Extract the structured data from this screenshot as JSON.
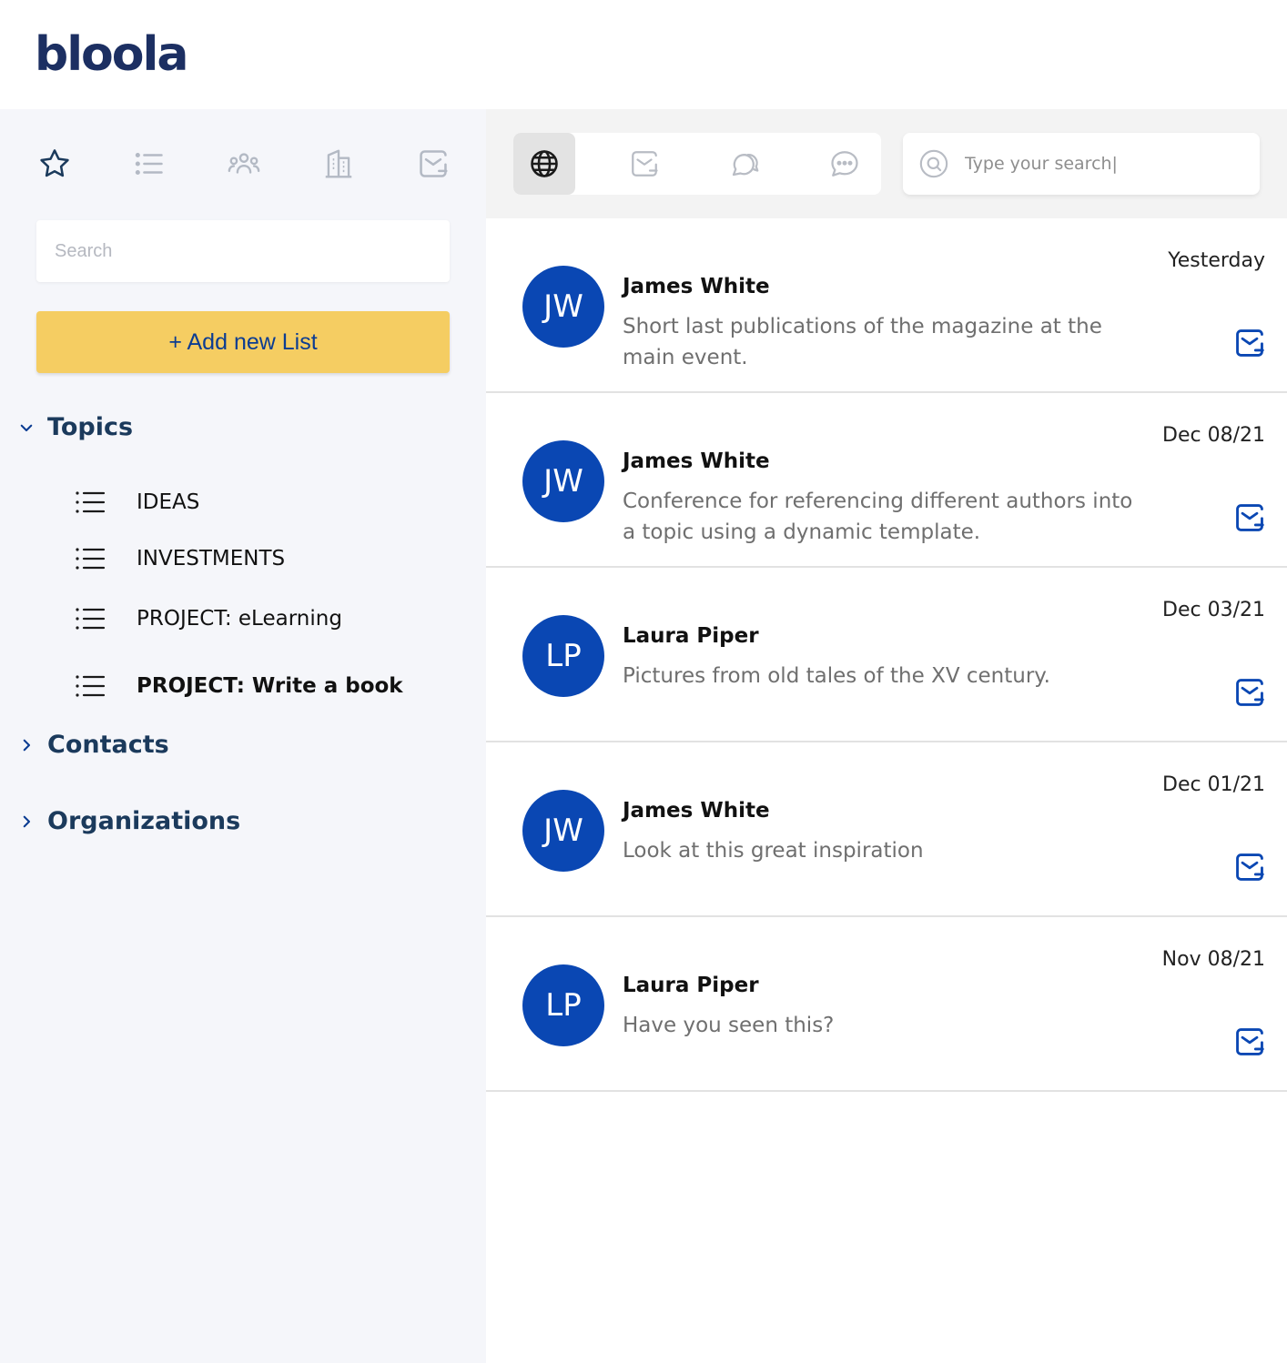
{
  "app": {
    "logo_text": "bloola"
  },
  "sidebar": {
    "tabs": [
      {
        "icon": "star-icon",
        "active": true
      },
      {
        "icon": "list-icon",
        "active": false
      },
      {
        "icon": "people-icon",
        "active": false
      },
      {
        "icon": "building-icon",
        "active": false
      },
      {
        "icon": "mail-icon",
        "active": false
      }
    ],
    "search_placeholder": "Search",
    "add_button_label": "+ Add new List",
    "sections": {
      "topics": {
        "label": "Topics",
        "expanded": true
      },
      "contacts": {
        "label": "Contacts",
        "expanded": false
      },
      "organizations": {
        "label": "Organizations",
        "expanded": false
      }
    },
    "topics": [
      {
        "label": "IDEAS",
        "active": false
      },
      {
        "label": "INVESTMENTS",
        "active": false
      },
      {
        "label": "PROJECT: eLearning",
        "active": false
      },
      {
        "label": "PROJECT: Write a book",
        "active": true
      }
    ]
  },
  "main": {
    "tabs": [
      {
        "icon": "globe-icon",
        "active": true
      },
      {
        "icon": "mail-icon",
        "active": false
      },
      {
        "icon": "chat-bubbles-icon",
        "active": false
      },
      {
        "icon": "comment-icon",
        "active": false
      }
    ],
    "search_placeholder": "Type your search|",
    "messages": [
      {
        "initials": "JW",
        "sender": "James White",
        "preview": "Short last publications of the magazine at the main event.",
        "date": "Yesterday"
      },
      {
        "initials": "JW",
        "sender": "James White",
        "preview": "Conference for referencing different authors into a topic using a dynamic template.",
        "date": "Dec 08/21"
      },
      {
        "initials": "LP",
        "sender": "Laura Piper",
        "preview": "Pictures from old tales of the XV century.",
        "date": "Dec 03/21"
      },
      {
        "initials": "JW",
        "sender": "James White",
        "preview": "Look at this great inspiration",
        "date": "Dec 01/21"
      },
      {
        "initials": "LP",
        "sender": "Laura Piper",
        "preview": "Have you seen this?",
        "date": "Nov 08/21"
      }
    ]
  },
  "colors": {
    "brand_navy": "#1c2f62",
    "accent_yellow": "#f5cd62",
    "avatar_blue": "#0a47b3",
    "link_blue": "#0b3c92"
  }
}
